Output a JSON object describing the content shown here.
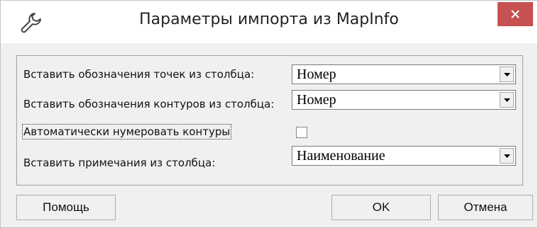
{
  "window": {
    "title": "Параметры импорта из MapInfo"
  },
  "rows": [
    {
      "label": "Вставить обозначения точек из столбца:",
      "value": "Номер"
    },
    {
      "label": "Вставить обозначения контуров из столбца:",
      "value": "Номер"
    },
    {
      "label": "Автоматически нумеровать контуры",
      "checked": false
    },
    {
      "label": "Вставить примечания из столбца:",
      "value": "Наименование"
    }
  ],
  "buttons": {
    "help": "Помощь",
    "ok": "OK",
    "cancel": "Отмена"
  },
  "icons": {
    "app": "wrench-icon",
    "close": "close-icon",
    "dropdown": "chevron-down-icon"
  },
  "colors": {
    "close_button": "#c75050",
    "dialog_bg": "#f0f0f0"
  }
}
